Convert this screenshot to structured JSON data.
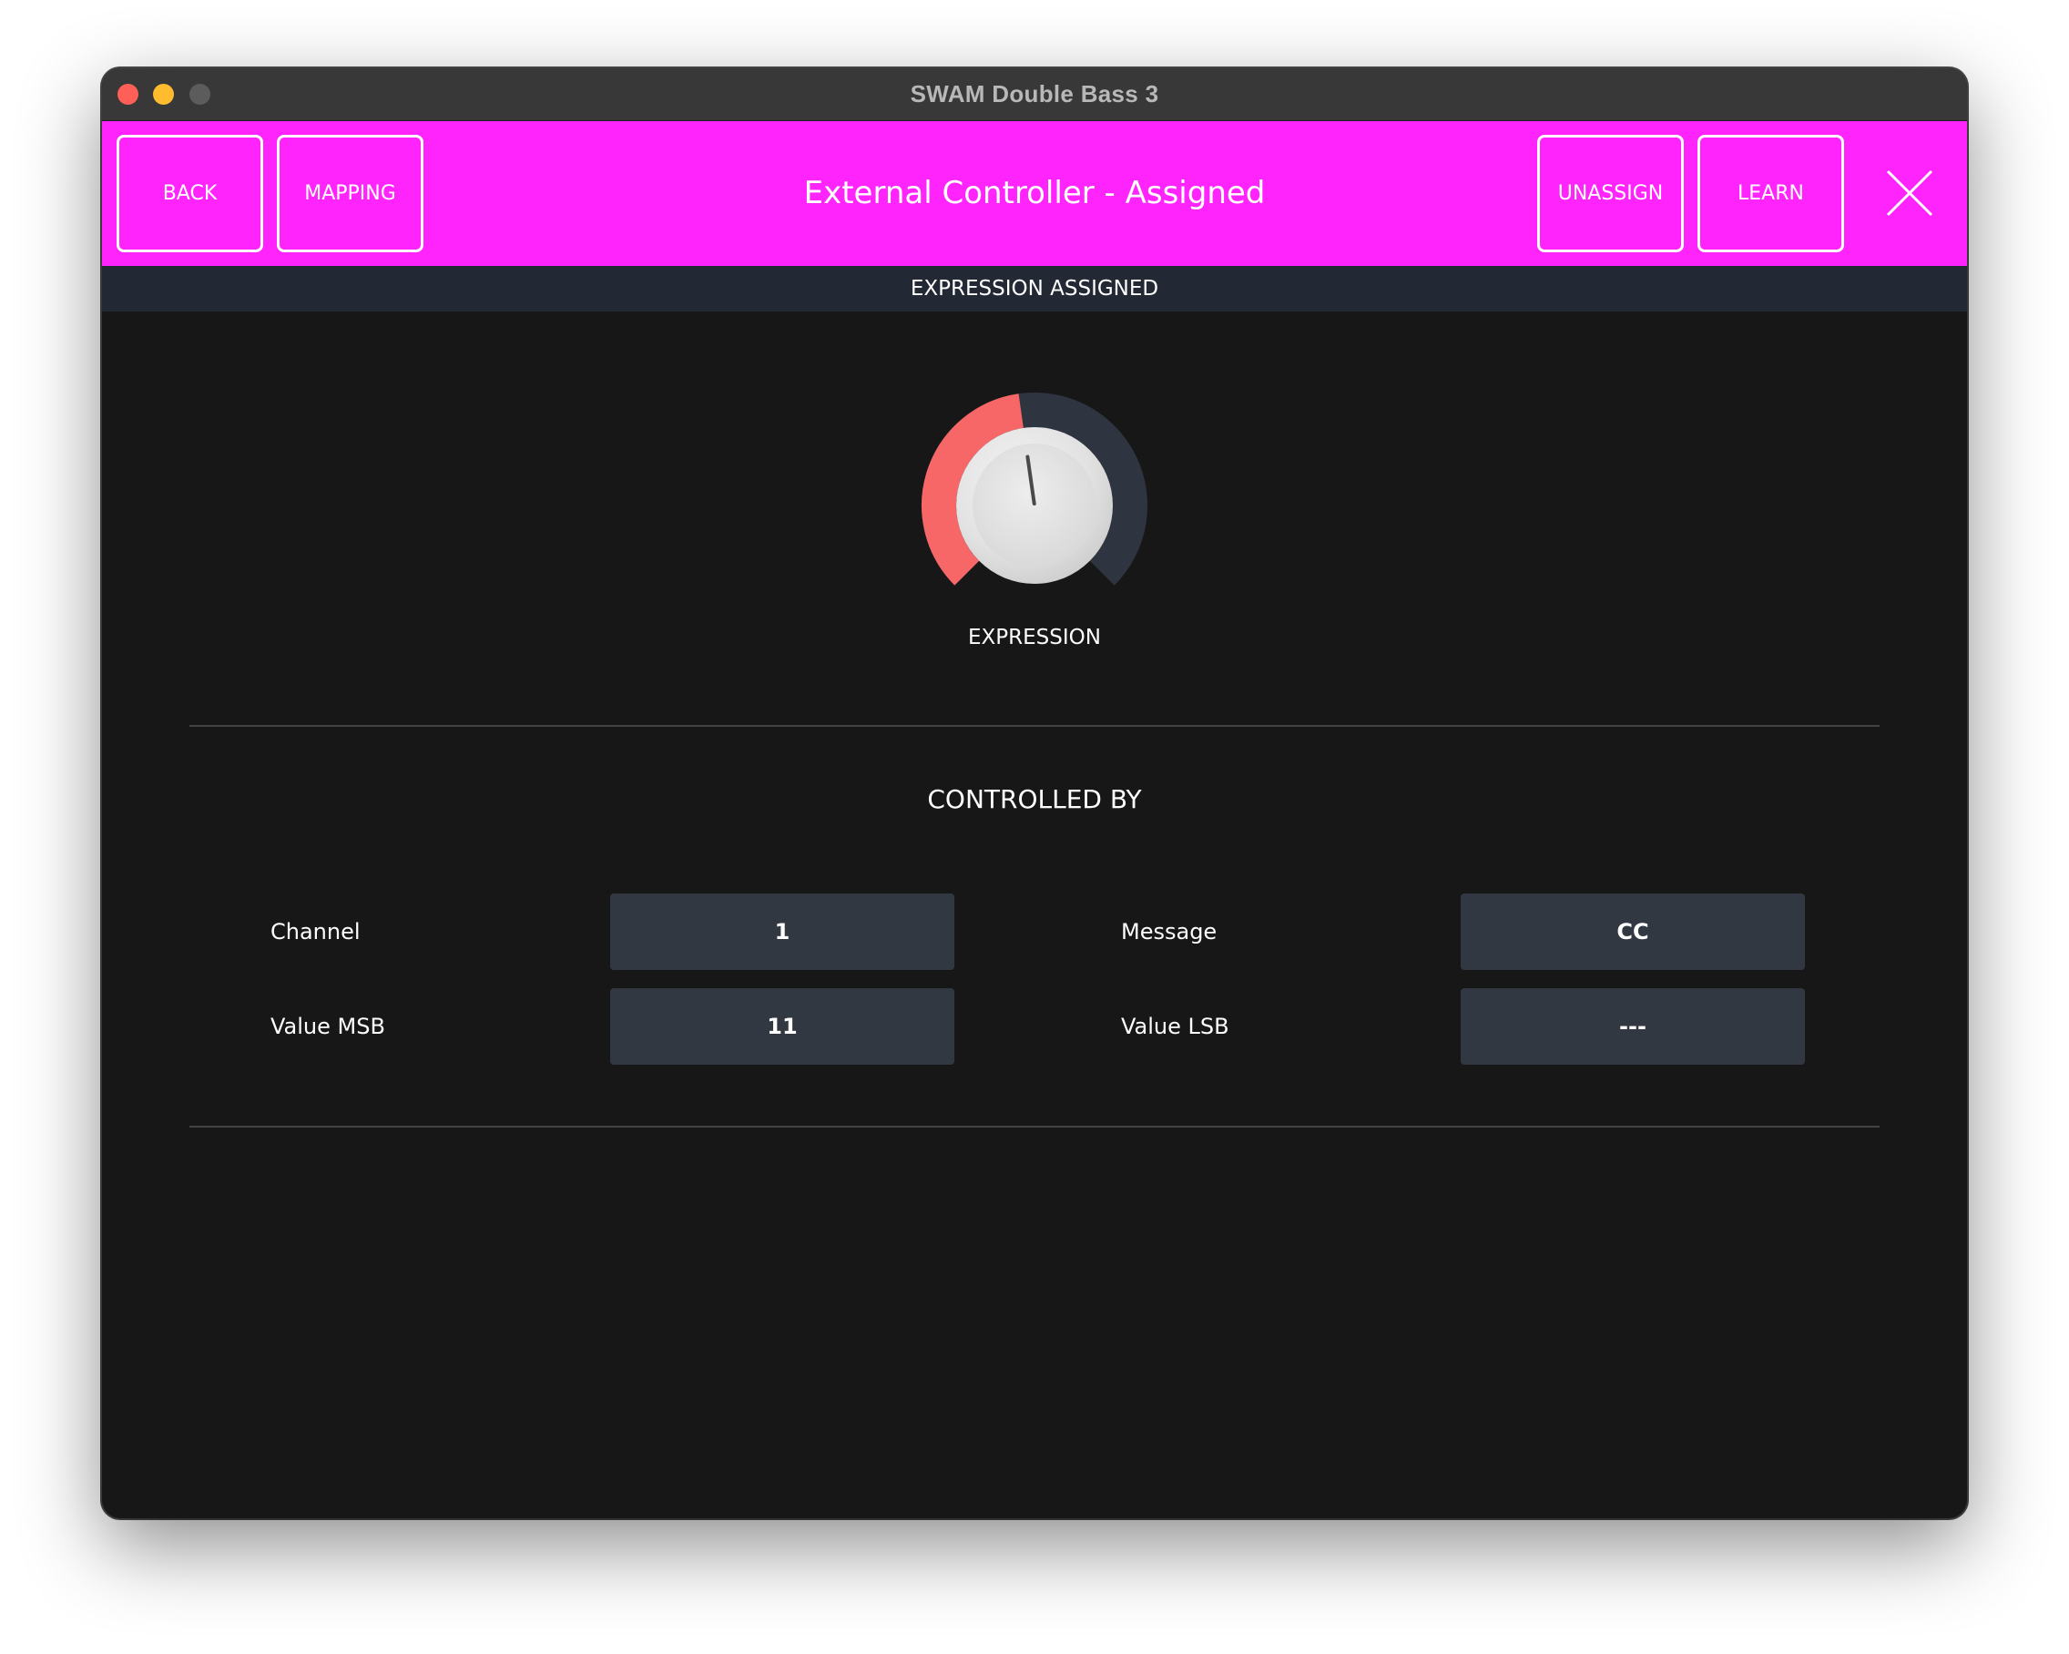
{
  "window": {
    "title": "SWAM Double Bass 3"
  },
  "header": {
    "back_label": "BACK",
    "mapping_label": "MAPPING",
    "title": "External Controller - Assigned",
    "unassign_label": "UNASSIGN",
    "learn_label": "LEARN",
    "close_icon": "close-x-icon"
  },
  "status": {
    "text": "EXPRESSION ASSIGNED"
  },
  "knob": {
    "label": "EXPRESSION",
    "value_fraction": 0.47,
    "active_color": "#f86767",
    "track_color": "#2f3540"
  },
  "controlled_by": {
    "title": "CONTROLLED BY",
    "fields": {
      "channel_label": "Channel",
      "channel_value": "1",
      "message_label": "Message",
      "message_value": "CC",
      "value_msb_label": "Value MSB",
      "value_msb_value": "11",
      "value_lsb_label": "Value LSB",
      "value_lsb_value": "---"
    }
  },
  "colors": {
    "accent": "#ff24fc",
    "background": "#171717",
    "status_bar": "#222834",
    "field_bg": "#323842"
  }
}
